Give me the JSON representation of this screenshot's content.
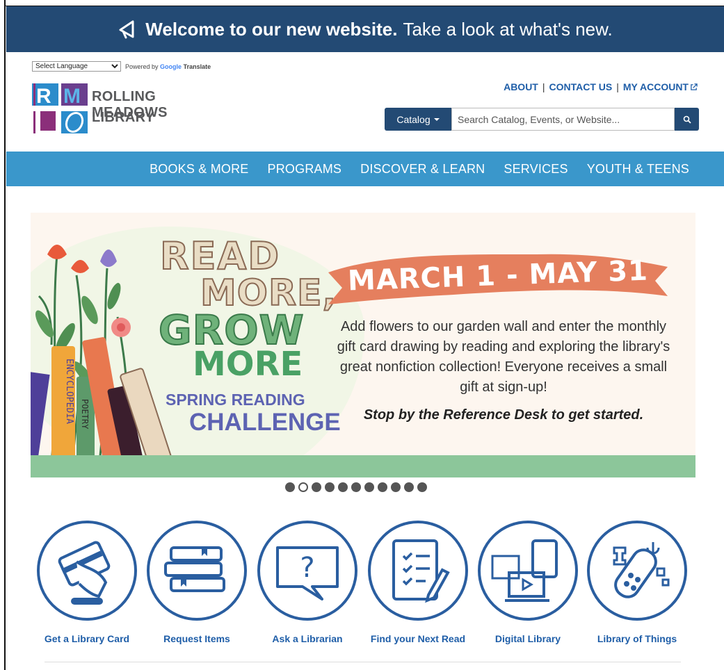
{
  "announcement": {
    "bold": "Welcome to our new website.",
    "rest": "Take a look at what's new."
  },
  "language": {
    "select_value": "Select Language",
    "powered_prefix": "Powered by",
    "google": "Google",
    "translate": "Translate"
  },
  "logo": {
    "line1": "ROLLING MEADOWS",
    "line2": "LIBRARY",
    "letters": [
      "R",
      "M"
    ]
  },
  "toplinks": {
    "about": "ABOUT",
    "contact": "CONTACT US",
    "account": "MY ACCOUNT",
    "separator": "|"
  },
  "search": {
    "scope_label": "Catalog",
    "placeholder": "Search Catalog, Events, or Website..."
  },
  "nav": {
    "items": [
      {
        "label": "BOOKS & MORE"
      },
      {
        "label": "PROGRAMS"
      },
      {
        "label": "DISCOVER & LEARN"
      },
      {
        "label": "SERVICES"
      },
      {
        "label": "YOUTH & TEENS"
      }
    ]
  },
  "banner": {
    "headline1": "READ",
    "headline2": "MORE,",
    "headline3": "GROW",
    "headline4": "MORE",
    "subhead1": "SPRING READING",
    "subhead2": "CHALLENGE",
    "dates": "MARCH 1 - MAY 31",
    "description": "Add flowers to our garden wall and enter the monthly gift card drawing by reading and exploring the library's great nonfiction collection! Everyone receives a small gift at sign-up!",
    "cta": "Stop by the Reference Desk to get started.",
    "book_labels": [
      "ENCYCLOPEDIA",
      "POETRY"
    ]
  },
  "carousel": {
    "total": 11,
    "active_index": 1
  },
  "quicklinks": [
    {
      "label": "Get a Library Card",
      "icon": "library-card-icon"
    },
    {
      "label": "Request Items",
      "icon": "books-stack-icon"
    },
    {
      "label": "Ask a Librarian",
      "icon": "question-bubble-icon"
    },
    {
      "label": "Find your Next Read",
      "icon": "notebook-checklist-icon"
    },
    {
      "label": "Digital Library",
      "icon": "digital-devices-icon"
    },
    {
      "label": "Library of Things",
      "icon": "things-icon"
    }
  ],
  "colors": {
    "navy": "#234a74",
    "nav_blue": "#3a97cb",
    "link_blue": "#1f5ea8",
    "icon_blue": "#2a5ea0",
    "ribbon": "#e57f5e"
  }
}
